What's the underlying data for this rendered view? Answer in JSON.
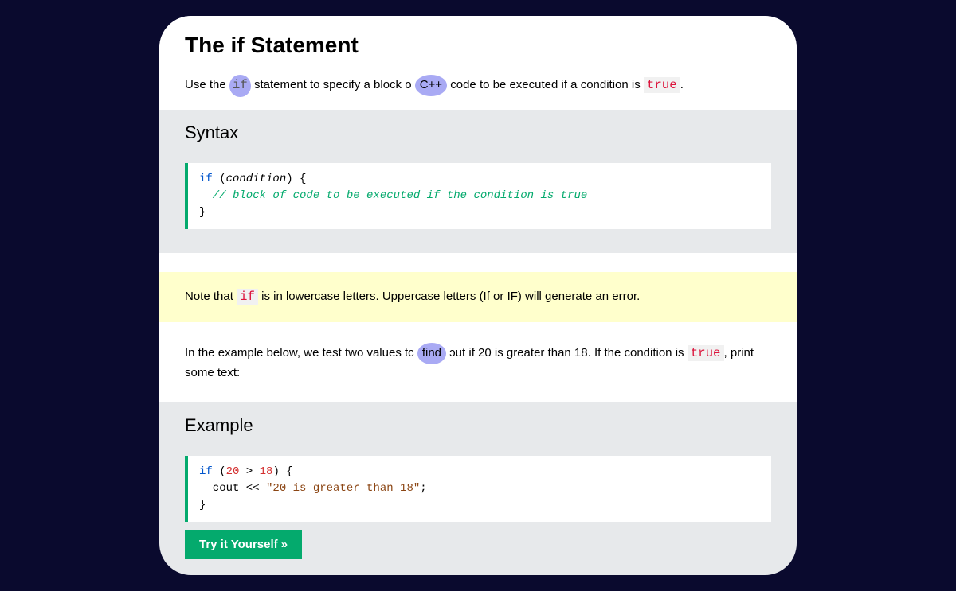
{
  "header": {
    "title": "The if Statement"
  },
  "intro": {
    "pre": "Use the ",
    "code1": "if",
    "mid1": " statement to specify a block o ",
    "hl": "C++",
    "mid2": " code to be executed if a condition is ",
    "code2": "true",
    "end": "."
  },
  "syntax": {
    "heading": "Syntax",
    "kw": "if",
    "open": " (",
    "cond": "condition",
    "close": ") {",
    "comment": "  // block of code to be executed if the condition is true",
    "brace": "}"
  },
  "note": {
    "pre": "Note that ",
    "code": "if",
    "post": " is in lowercase letters. Uppercase letters (If or IF) will generate an error."
  },
  "example_intro": {
    "pre": "In the example below, we test two values tc ",
    "hl": "find",
    "mid": " ɔut if 20 is greater than 18. If the condition is ",
    "code": "true",
    "end": ", print some text:"
  },
  "example": {
    "heading": "Example",
    "kw": "if",
    "open": " (",
    "n1": "20",
    "op": " > ",
    "n2": "18",
    "close": ") {",
    "line2a": "  cout << ",
    "str": "\"20 is greater than 18\"",
    "line2b": ";",
    "brace": "}"
  },
  "button": {
    "label": "Try it Yourself »"
  }
}
